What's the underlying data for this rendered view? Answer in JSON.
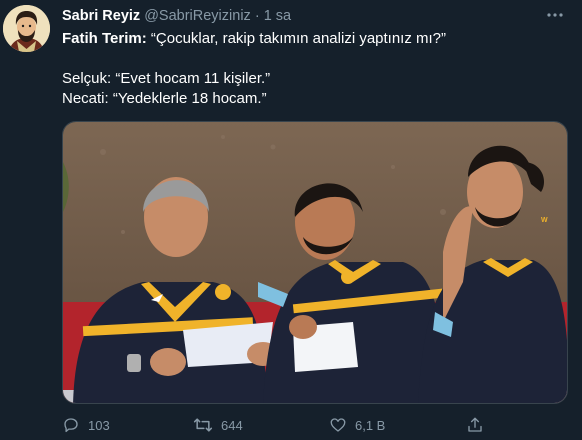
{
  "author": {
    "name": "Sabri Reyiz",
    "handle": "@SabriReyiziniz",
    "separator": "·",
    "time": "1 sa",
    "avatar_icon": "avatar-illustration"
  },
  "more_icon": "more-dots-icon",
  "text": {
    "line1_speaker": "Fatih Terim:",
    "line1_quote": "“Çocuklar, rakip takımın analizi yaptınız mı?”",
    "line2_speaker": "Selçuk:",
    "line2_quote": "“Evet hocam 11 kişiler.”",
    "line3_speaker": "Necati:",
    "line3_quote": "“Yedeklerle 18 hocam.”"
  },
  "media": {
    "description_icon": "photo",
    "colors": {
      "dirt": "#6f5a47",
      "jersey": "#1d2337",
      "accent": "#f0b32a",
      "red": "#b3242c"
    }
  },
  "actions": {
    "reply_count": "103",
    "retweet_count": "644",
    "like_count": "6,1 B",
    "reply_icon": "reply-icon",
    "retweet_icon": "retweet-icon",
    "like_icon": "heart-icon",
    "share_icon": "share-icon"
  },
  "colors": {
    "background": "#15202b",
    "muted": "#8899a6",
    "text": "#ffffff"
  }
}
